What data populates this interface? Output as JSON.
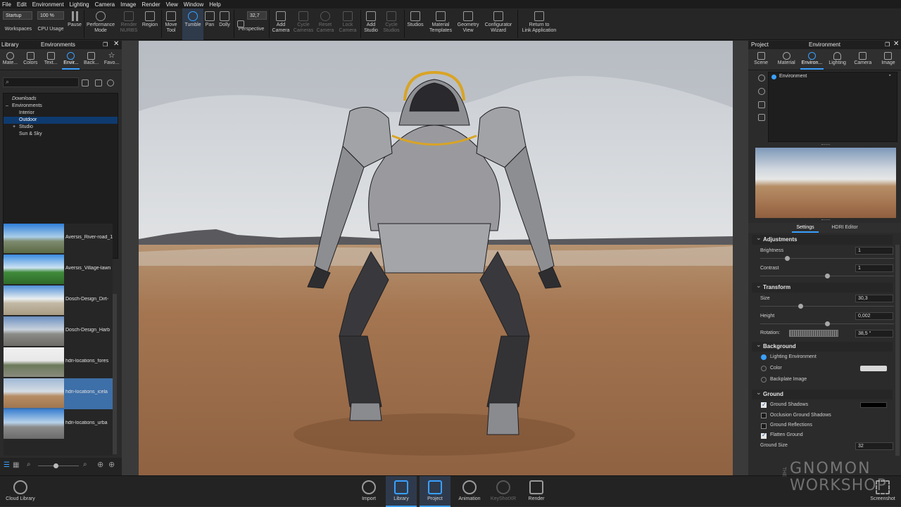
{
  "menu": [
    "File",
    "Edit",
    "Environment",
    "Lighting",
    "Camera",
    "Image",
    "Render",
    "View",
    "Window",
    "Help"
  ],
  "toolbar": {
    "workspace_value": "Startup",
    "workspace_label": "Workspaces",
    "cpu_value": "100 %",
    "cpu_label": "CPU Usage",
    "pause_label": "Pause",
    "performance_label": "Performance",
    "performance_label2": "Mode",
    "render_nurbs_label": "Render",
    "render_nurbs_label2": "NURBS",
    "region_label": "Region",
    "move_tool_label": "Move",
    "move_tool_label2": "Tool",
    "tumble_label": "Tumble",
    "pan_label": "Pan",
    "dolly_label": "Dolly",
    "fov_value": "32,7",
    "perspective_label": "Perspective",
    "add_camera_label": "Add",
    "add_camera_label2": "Camera",
    "cycle_cameras_label": "Cycle",
    "cycle_cameras_label2": "Cameras",
    "reset_camera_label": "Reset",
    "reset_camera_label2": "Camera",
    "lock_camera_label": "Lock",
    "lock_camera_label2": "Camera",
    "add_studio_label": "Add",
    "add_studio_label2": "Studio",
    "cycle_studios_label": "Cycle",
    "cycle_studios_label2": "Studios",
    "studios_label": "Studios",
    "material_templates_label": "Material",
    "material_templates_label2": "Templates",
    "geometry_view_label": "Geometry",
    "geometry_view_label2": "View",
    "configurator_label": "Configurator",
    "configurator_label2": "Wizard",
    "return_label": "Return to",
    "return_label2": "Link Application"
  },
  "library": {
    "panel_label": "Library",
    "title": "Environments",
    "tabs": [
      "Mate...",
      "Colors",
      "Text...",
      "Envir...",
      "Back...",
      "Favo..."
    ],
    "tree": [
      "Downloads",
      "Environments",
      "Interior",
      "Outdoor",
      "Studio",
      "Sun & Sky"
    ],
    "items": [
      "Aversis_River-road_1",
      "Aversis_Village-lawn",
      "Dosch-Design_Dirt-",
      "Dosch-Design_Harb",
      "hdri-locations_fores",
      "hdri-locations_icela",
      "hdri-locations_urba"
    ]
  },
  "project": {
    "panel_label": "Project",
    "title": "Environment",
    "tabs": [
      "Scene",
      "Material",
      "Environ...",
      "Lighting",
      "Camera",
      "Image"
    ],
    "env_item": "Environment",
    "subtabs": [
      "Settings",
      "HDRI Editor"
    ],
    "adjustments": {
      "title": "Adjustments",
      "brightness_label": "Brightness",
      "brightness_value": "1",
      "brightness_slider": 0.2,
      "contrast_label": "Contrast",
      "contrast_value": "1",
      "contrast_slider": 0.5
    },
    "transform": {
      "title": "Transform",
      "size_label": "Size",
      "size_value": "30,3",
      "size_slider": 0.3,
      "height_label": "Height",
      "height_value": "0,002",
      "height_slider": 0.5,
      "rotation_label": "Rotation:",
      "rotation_value": "38,5 °"
    },
    "background": {
      "title": "Background",
      "options": [
        "Lighting Environment",
        "Color",
        "Backplate Image"
      ],
      "selected": 0,
      "color_swatch": "#d8d8d8"
    },
    "ground": {
      "title": "Ground",
      "options": [
        {
          "label": "Ground Shadows",
          "checked": true
        },
        {
          "label": "Occlusion Ground Shadows",
          "checked": false
        },
        {
          "label": "Ground Reflections",
          "checked": false
        },
        {
          "label": "Flatten Ground",
          "checked": true
        }
      ],
      "shadow_color": "#000000",
      "size_label": "Ground Size",
      "size_value": "32"
    }
  },
  "bottom": {
    "cloud_label": "Cloud Library",
    "tabs": [
      "Import",
      "Library",
      "Project",
      "Animation",
      "KeyShotXR",
      "Render"
    ],
    "active_tabs": [
      "Library",
      "Project"
    ],
    "screenshot_label": "Screenshot"
  },
  "watermark": [
    "THE",
    "GNOMON",
    "WORKSHOP"
  ],
  "colors": {
    "accent": "#3aa0ff",
    "selection": "#3d6fa8"
  }
}
